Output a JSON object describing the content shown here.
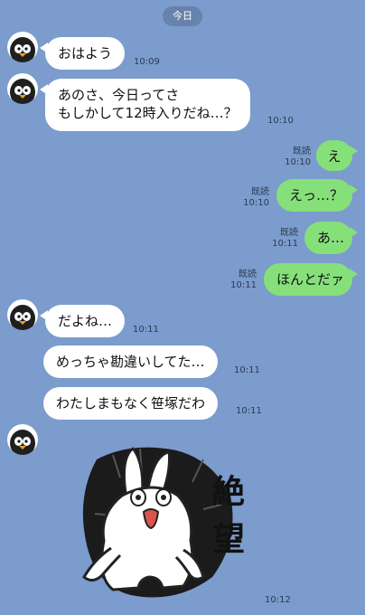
{
  "chat": {
    "date_label": "今日",
    "read_label": "既読",
    "messages": [
      {
        "side": "in",
        "text": "おはよう",
        "time": "10:09"
      },
      {
        "side": "in",
        "text_lines": [
          "あのさ、今日ってさ",
          "もしかして12時入りだね…？"
        ],
        "time": "10:10"
      },
      {
        "side": "out",
        "text": "え",
        "time": "10:10",
        "read": "既読"
      },
      {
        "side": "out",
        "text": "えっ…？",
        "time": "10:10",
        "read": "既読"
      },
      {
        "side": "out",
        "text": "あ…",
        "time": "10:11",
        "read": "既読"
      },
      {
        "side": "out",
        "text": "ほんとだァ",
        "time": "10:11",
        "read": "既読"
      },
      {
        "side": "in",
        "text": "だよね…",
        "time": "10:11"
      },
      {
        "side": "in",
        "text": "めっちゃ勘違いしてた…",
        "time": "10:11"
      },
      {
        "side": "in",
        "text": "わたしまもなく笹塚だわ",
        "time": "10:11"
      },
      {
        "side": "in",
        "type": "sticker",
        "sticker_text": "絶望",
        "time": "10:12"
      }
    ]
  },
  "icons": {
    "avatar": "penguin-avatar-icon",
    "sticker": "rabbit-sticker"
  },
  "colors": {
    "background": "#7b9ccd",
    "incoming_bubble": "#ffffff",
    "outgoing_bubble": "#85e07a"
  }
}
